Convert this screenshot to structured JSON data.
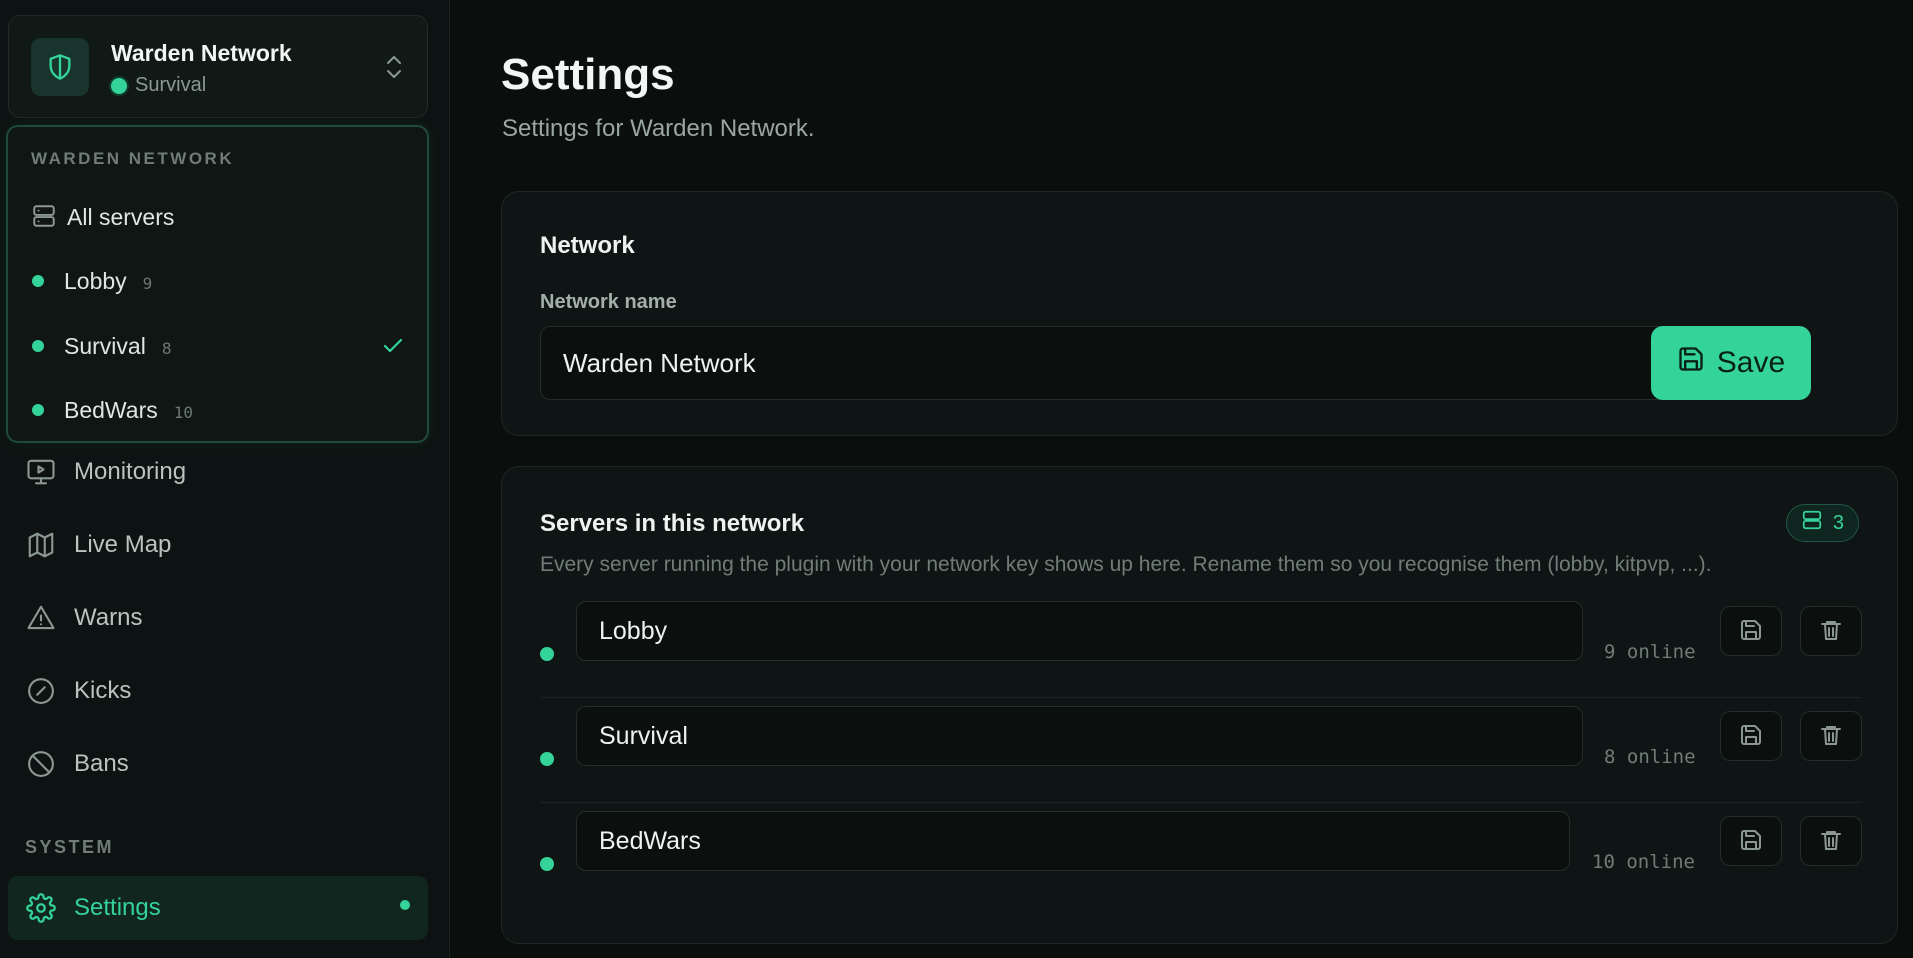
{
  "switcher": {
    "title": "Warden Network",
    "subtitle": "Survival",
    "logo_icon": "shield-icon",
    "toggle_icon": "chevrons-up-down-icon"
  },
  "dropdown": {
    "heading": "WARDEN NETWORK",
    "all_servers_label": "All servers",
    "servers": [
      {
        "label": "Lobby",
        "count": "9",
        "selected": false
      },
      {
        "label": "Survival",
        "count": "8",
        "selected": true
      },
      {
        "label": "BedWars",
        "count": "10",
        "selected": false
      }
    ]
  },
  "nav": {
    "items": [
      {
        "label": "Monitoring",
        "icon": "monitor-play-icon"
      },
      {
        "label": "Live Map",
        "icon": "map-icon"
      },
      {
        "label": "Warns",
        "icon": "warning-triangle-icon"
      },
      {
        "label": "Kicks",
        "icon": "compass-slash-icon"
      },
      {
        "label": "Bans",
        "icon": "ban-icon"
      }
    ],
    "system_label": "SYSTEM",
    "settings_label": "Settings"
  },
  "page": {
    "title": "Settings",
    "subtitle": "Settings for Warden Network."
  },
  "network_card": {
    "title": "Network",
    "field_label": "Network name",
    "field_value": "Warden Network",
    "save_label": "Save"
  },
  "servers_card": {
    "title": "Servers in this network",
    "count": "3",
    "description": "Every server running the plugin with your network key shows up here. Rename them so you recognise them (lobby, kitpvp, ...).",
    "rows": [
      {
        "name": "Lobby",
        "online": "9 online"
      },
      {
        "name": "Survival",
        "online": "8 online"
      },
      {
        "name": "BedWars",
        "online": "10 online"
      }
    ]
  },
  "colors": {
    "accent": "#34d399",
    "background": "#0a0e0d",
    "card": "#0f1514"
  }
}
